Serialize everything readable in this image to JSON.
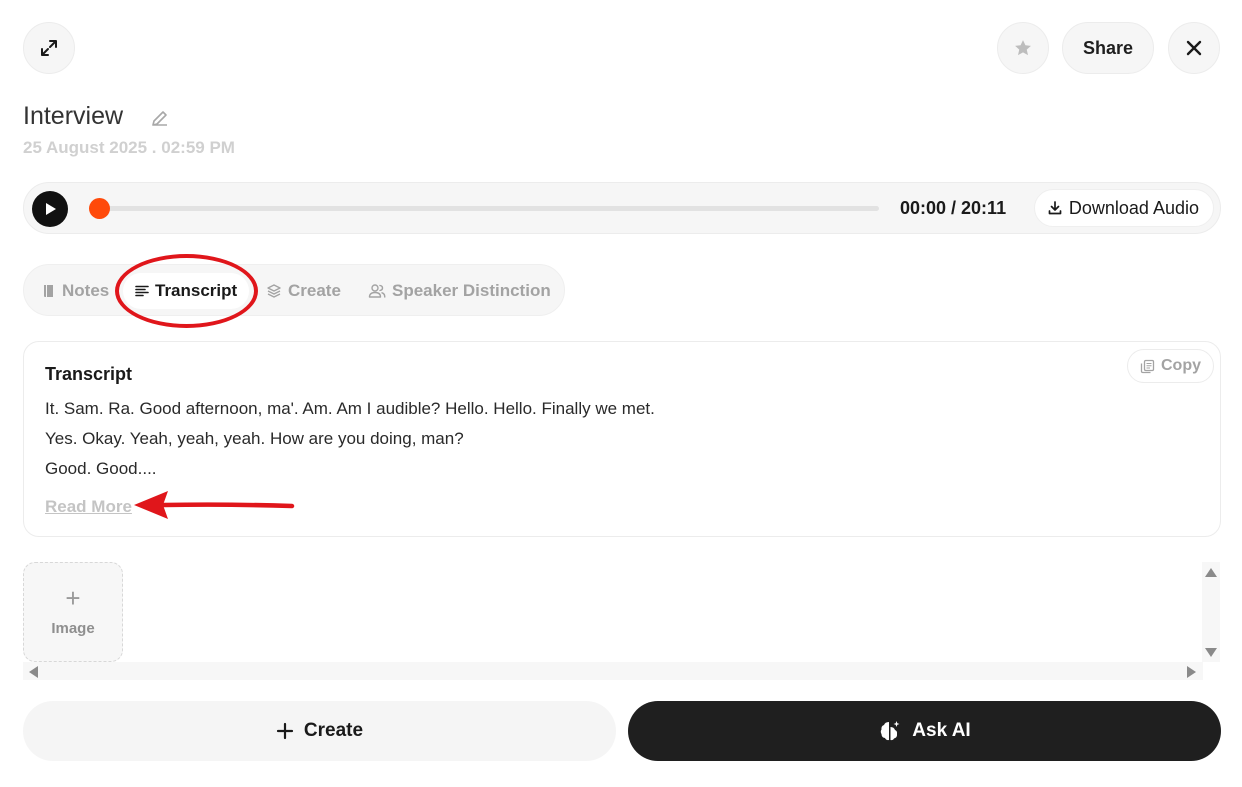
{
  "header": {
    "share_label": "Share"
  },
  "note": {
    "title": "Interview",
    "datetime": "25 August 2025 . 02:59 PM"
  },
  "player": {
    "time": "00:00 / 20:11",
    "download_label": "Download Audio",
    "progress": 0,
    "accent": "#ff4a0a"
  },
  "tabs": [
    {
      "label": "Notes",
      "icon": "book-icon",
      "active": false
    },
    {
      "label": "Transcript",
      "icon": "lines-icon",
      "active": true
    },
    {
      "label": "Create",
      "icon": "layers-icon",
      "active": false
    },
    {
      "label": "Speaker Distinction",
      "icon": "users-icon",
      "active": false
    }
  ],
  "transcript": {
    "title": "Transcript",
    "copy_label": "Copy",
    "lines": [
      "It. Sam. Ra. Good afternoon, ma'. Am. Am I audible? Hello. Hello. Finally we met.",
      "Yes. Okay. Yeah, yeah, yeah. How are you doing, man?",
      "Good. Good...."
    ],
    "read_more": "Read More"
  },
  "attachments": {
    "image_label": "Image"
  },
  "footer": {
    "create_label": "Create",
    "ask_label": "Ask AI"
  },
  "annotation_color": "#e0161b"
}
